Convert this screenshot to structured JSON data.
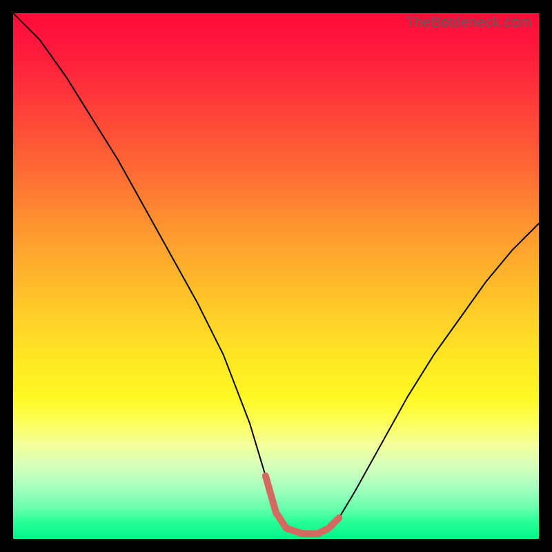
{
  "watermark": "TheBottleneck.com",
  "chart_data": {
    "type": "line",
    "title": "",
    "xlabel": "",
    "ylabel": "",
    "xlim": [
      0,
      100
    ],
    "ylim": [
      0,
      100
    ],
    "legend": false,
    "grid": false,
    "background_gradient": {
      "direction": "vertical",
      "stops": [
        {
          "pos": 0,
          "color": "#ff0b3a"
        },
        {
          "pos": 18,
          "color": "#ff3f3a"
        },
        {
          "pos": 42,
          "color": "#ff9a2f"
        },
        {
          "pos": 66,
          "color": "#ffe824"
        },
        {
          "pos": 82,
          "color": "#f3ff9a"
        },
        {
          "pos": 94,
          "color": "#6affad"
        },
        {
          "pos": 100,
          "color": "#00f58a"
        }
      ]
    },
    "series": [
      {
        "name": "bottleneck-curve",
        "color": "#000000",
        "x": [
          0,
          2,
          5,
          10,
          15,
          20,
          25,
          30,
          35,
          40,
          45,
          48,
          50,
          52,
          55,
          58,
          60,
          62,
          65,
          70,
          75,
          80,
          85,
          90,
          95,
          100
        ],
        "y": [
          100,
          98,
          95,
          88,
          80,
          72,
          63,
          54,
          45,
          35,
          22,
          12,
          5,
          2,
          1,
          1,
          2,
          4,
          9,
          18,
          27,
          35,
          42,
          49,
          55,
          60
        ]
      },
      {
        "name": "optimal-range-highlight",
        "color": "#d46a5f",
        "x": [
          48,
          50,
          52,
          55,
          58,
          60,
          62
        ],
        "y": [
          12,
          5,
          2,
          1,
          1,
          2,
          4
        ]
      }
    ],
    "annotations": []
  }
}
